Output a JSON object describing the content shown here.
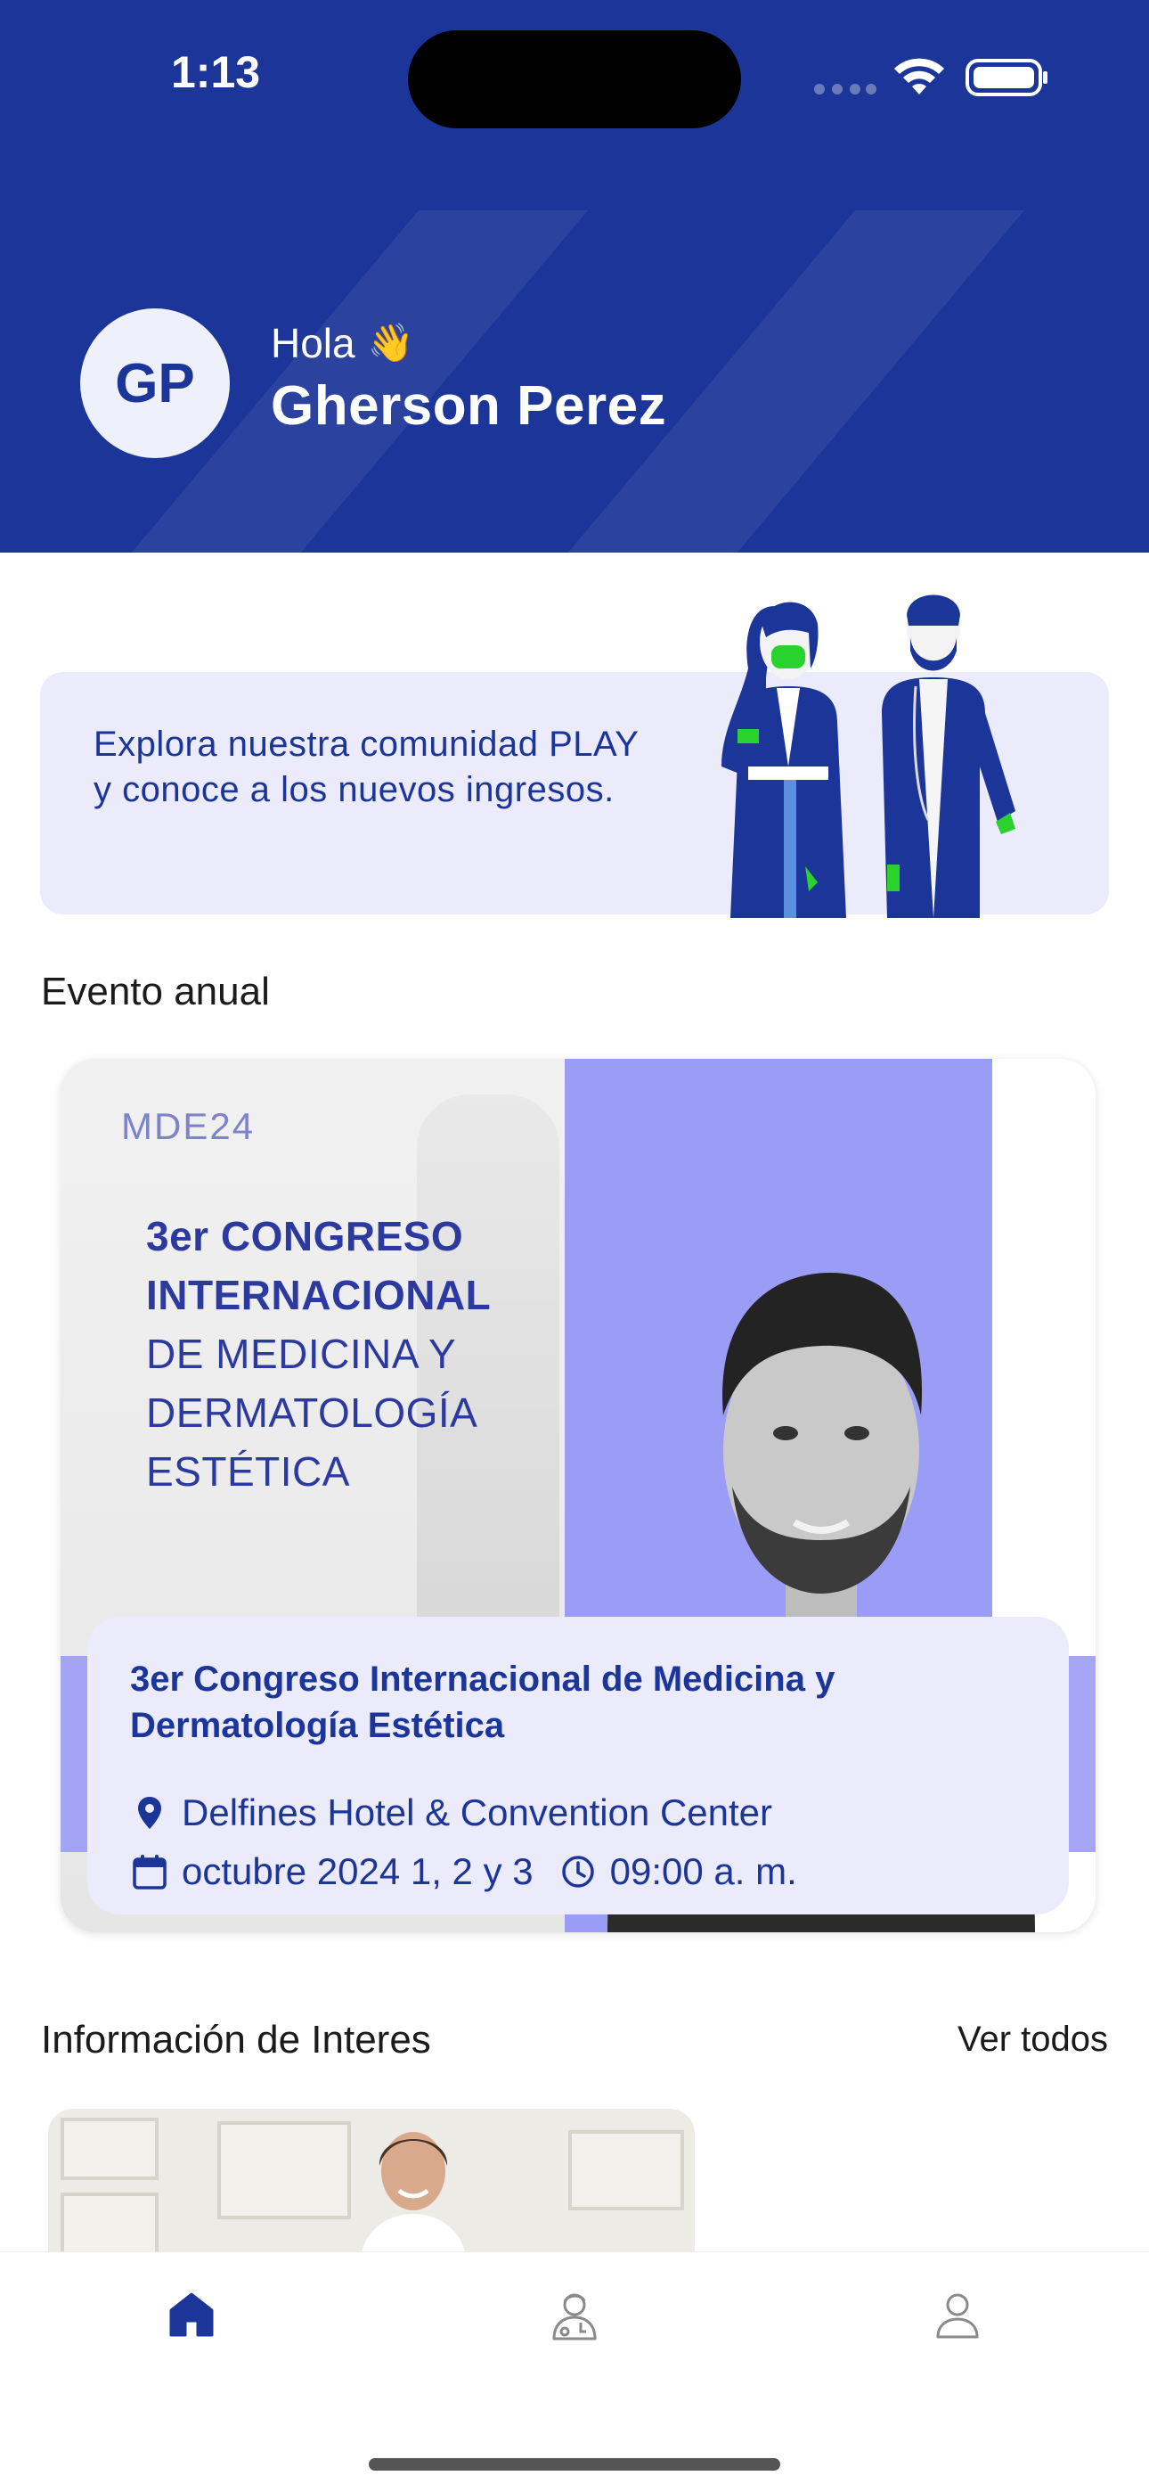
{
  "status_bar": {
    "time": "1:13"
  },
  "header": {
    "avatar_initials": "GP",
    "greeting": "Hola",
    "greeting_emoji": "👋",
    "user_name": "Gherson Perez"
  },
  "community_banner": {
    "text": "Explora nuestra comunidad PLAY y conoce a los nuevos ingresos."
  },
  "annual_event": {
    "section_title": "Evento anual",
    "poster_logo": "MDE24",
    "poster_heading_bold_1": "3er CONGRESO",
    "poster_heading_bold_2": "INTERNACIONAL",
    "poster_heading_rest_1": "DE MEDICINA Y",
    "poster_heading_rest_2": "DERMATOLOGÍA",
    "poster_heading_rest_3": "ESTÉTICA",
    "title": "3er Congreso Internacional de Medicina y Dermatología Estética",
    "location": "Delfines Hotel & Convention Center",
    "date": "octubre 2024 1, 2 y 3",
    "time": "09:00 a. m."
  },
  "info_section": {
    "title": "Información de Interes",
    "see_all_label": "Ver todos"
  },
  "bottom_nav": {
    "items": [
      {
        "icon": "home-icon",
        "active": true
      },
      {
        "icon": "doctor-icon",
        "active": false
      },
      {
        "icon": "user-icon",
        "active": false
      }
    ]
  },
  "colors": {
    "brand_blue": "#1b3598",
    "accent_purple": "#9b9cf5",
    "light_lavender": "#ebebfb",
    "inactive_icon": "#8a8a8a"
  }
}
